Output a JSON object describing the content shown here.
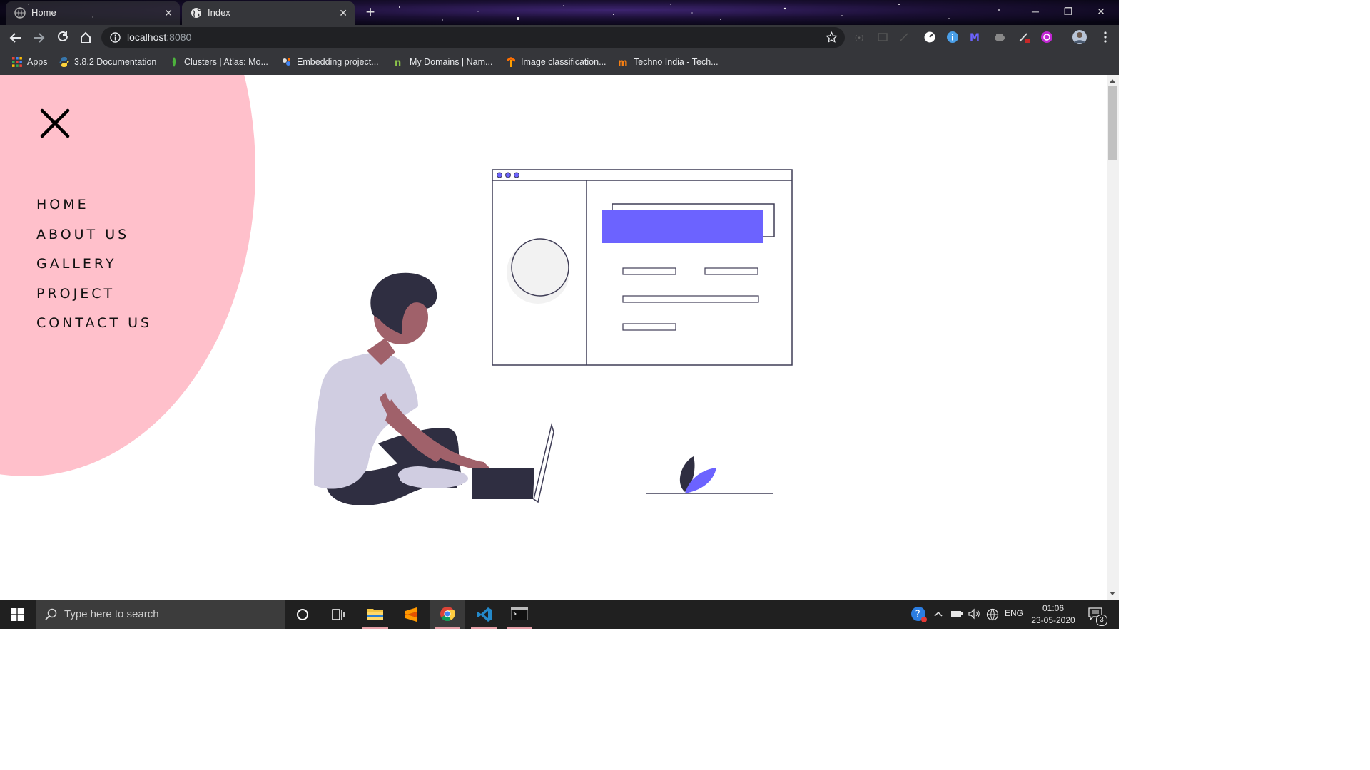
{
  "browser": {
    "tabs": [
      {
        "title": "Home",
        "active": false
      },
      {
        "title": "Index",
        "active": true
      }
    ],
    "new_tab_label": "+",
    "window_controls": {
      "minimize": "─",
      "restore": "❐",
      "close": "✕"
    },
    "url": {
      "host": "localhost",
      "port": ":8080"
    },
    "bookmarks": [
      {
        "label": "Apps",
        "icon": "apps-grid-icon"
      },
      {
        "label": "3.8.2 Documentation",
        "icon": "python-icon"
      },
      {
        "label": "Clusters | Atlas: Mo...",
        "icon": "mongodb-leaf-icon"
      },
      {
        "label": "Embedding project...",
        "icon": "tensorflow-icon"
      },
      {
        "label": "My Domains | Nam...",
        "icon": "namecheap-icon"
      },
      {
        "label": "Image classification...",
        "icon": "tensorflow-icon"
      },
      {
        "label": "Techno India - Tech...",
        "icon": "moodle-icon"
      }
    ]
  },
  "page": {
    "menu_close_icon": "close-icon",
    "menu_items": [
      "HOME",
      "ABOUT US",
      "GALLERY",
      "PROJECT",
      "CONTACT US"
    ],
    "colors": {
      "menu_background": "#ffc0cb",
      "accent": "#6c63ff",
      "figure_dark": "#2f2e41",
      "skin": "#a0616a"
    }
  },
  "taskbar": {
    "search_placeholder": "Type here to search",
    "apps": [
      "cortana",
      "task-view",
      "file-explorer",
      "sublime-text",
      "chrome",
      "vscode",
      "terminal"
    ],
    "tray_language": "ENG",
    "time": "01:06",
    "date": "23-05-2020",
    "notification_count": "3"
  }
}
